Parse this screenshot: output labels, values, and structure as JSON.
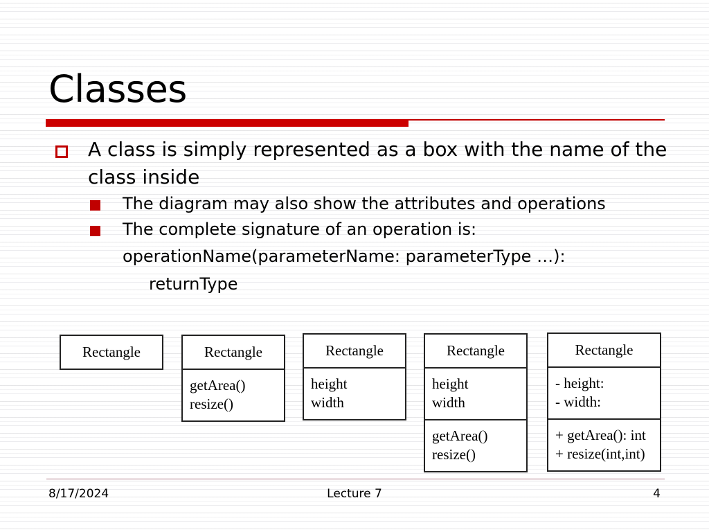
{
  "slide": {
    "title": "Classes",
    "accent_color": "#C00000",
    "accent_color_bar": "#CC0000",
    "background": "#FFFFFF"
  },
  "bullets": {
    "level1": [
      "A class is simply represented as a box with the name of the class inside"
    ],
    "level2": [
      "The diagram may also show the attributes and operations",
      "The complete signature of an operation is:"
    ],
    "continuation": {
      "line1": "operationName(parameterName: parameterType …):",
      "line2": "returnType"
    }
  },
  "uml_boxes": [
    {
      "name": "Rectangle",
      "attributes": [],
      "operations": []
    },
    {
      "name": "Rectangle",
      "attributes": [],
      "operations": [
        "getArea()",
        "resize()"
      ]
    },
    {
      "name": "Rectangle",
      "attributes": [
        "height",
        "width"
      ],
      "operations": []
    },
    {
      "name": "Rectangle",
      "attributes": [
        "height",
        "width"
      ],
      "operations": [
        "getArea()",
        "resize()"
      ]
    },
    {
      "name": "Rectangle",
      "attributes": [
        "- height:",
        "- width:"
      ],
      "operations": [
        "+ getArea(): int",
        "+ resize(int,int)"
      ]
    }
  ],
  "footer": {
    "date": "8/17/2024",
    "center": "Lecture 7",
    "page": "4"
  }
}
